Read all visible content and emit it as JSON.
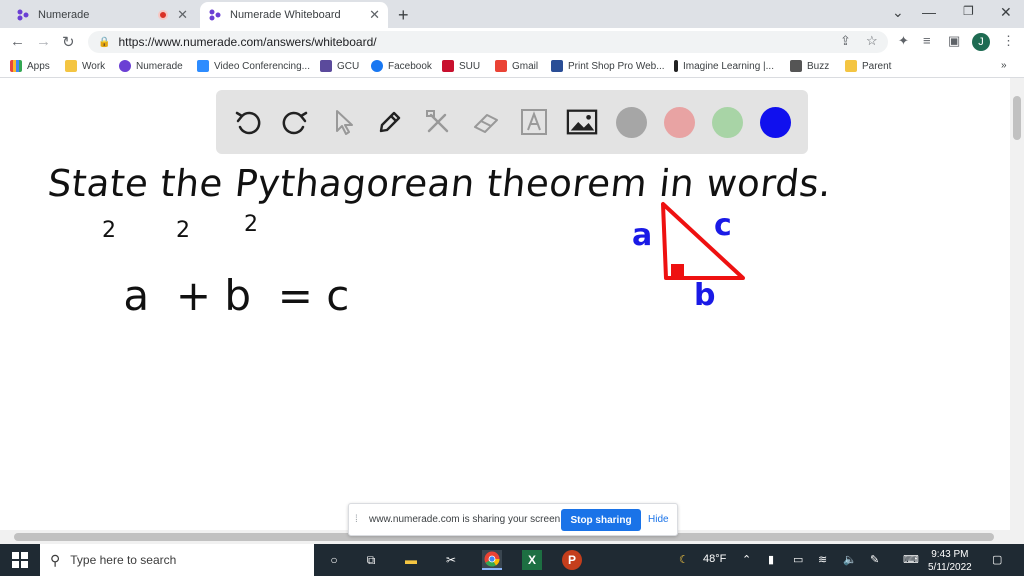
{
  "tabs": [
    {
      "title": "Numerade",
      "active": false
    },
    {
      "title": "Numerade Whiteboard",
      "active": true
    }
  ],
  "address": {
    "url": "https://www.numerade.com/answers/whiteboard/"
  },
  "profile_initial": "J",
  "bookmarks": [
    "Apps",
    "Work",
    "Numerade",
    "Video Conferencing...",
    "GCU",
    "Facebook",
    "SUU",
    "Gmail",
    "Print Shop Pro Web...",
    "Imagine Learning |...",
    "Buzz",
    "Parent"
  ],
  "bookmarks_more": "»",
  "whiteboard": {
    "tools": [
      "undo-icon",
      "redo-icon",
      "pointer-icon",
      "pen-icon",
      "tools-icon",
      "eraser-icon",
      "text-icon",
      "image-icon"
    ],
    "swatch_colors": [
      "#a6a6a6",
      "#e8a3a3",
      "#a8d4a6",
      "#1010ee"
    ],
    "handwriting": {
      "line1": "State the Pythagorean theorem in words.",
      "equation_base": "a  + b  = c",
      "sup_a": "2",
      "sup_b": "2",
      "sup_c": "2",
      "label_a": "a",
      "label_b": "b",
      "label_c": "c"
    },
    "ink_black": "#111111",
    "ink_blue": "#1a1ae6",
    "ink_red": "#ee1111"
  },
  "share_bar": {
    "message": "www.numerade.com is sharing your screen.",
    "stop_label": "Stop sharing",
    "hide_label": "Hide"
  },
  "taskbar": {
    "search_placeholder": "Type here to search",
    "temperature": "48°F",
    "time": "9:43 PM",
    "date": "5/11/2022"
  }
}
